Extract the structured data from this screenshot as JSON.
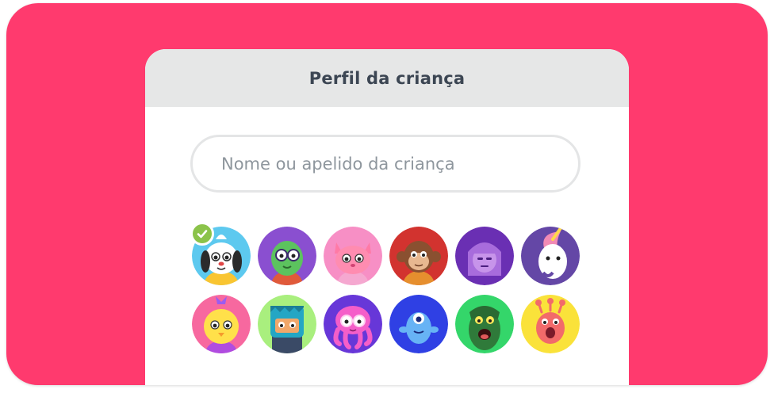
{
  "dialog": {
    "title": "Perfil da criança"
  },
  "name_field": {
    "placeholder": "Nome ou apelido da criança",
    "value": ""
  },
  "avatars": {
    "selected_index": 0,
    "items": [
      {
        "name": "white-dog",
        "bg": "#5dc9ef"
      },
      {
        "name": "green-owl",
        "bg": "#8a4fd0"
      },
      {
        "name": "pink-cat",
        "bg": "#f78fc5"
      },
      {
        "name": "monkey",
        "bg": "#d2332f"
      },
      {
        "name": "purple-girl",
        "bg": "#6a2fb3"
      },
      {
        "name": "white-unicorn",
        "bg": "#6447a6"
      },
      {
        "name": "yellow-chick",
        "bg": "#f7689f"
      },
      {
        "name": "teal-robot",
        "bg": "#a9ef7e"
      },
      {
        "name": "pink-octopus",
        "bg": "#6737d8"
      },
      {
        "name": "blue-monster",
        "bg": "#2f40e4"
      },
      {
        "name": "green-swamp-creature",
        "bg": "#34d66a"
      },
      {
        "name": "pink-alien",
        "bg": "#fae23a"
      }
    ]
  },
  "colors": {
    "background": "#ff3a6e",
    "header": "#e6e7e7",
    "check": "#8bc34a"
  }
}
